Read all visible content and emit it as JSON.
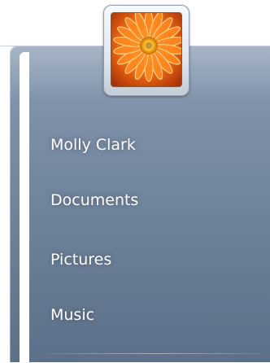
{
  "start_menu": {
    "user_picture_icon": "orange-gerbera-flower",
    "right_column": {
      "items": [
        {
          "label": "Molly Clark"
        },
        {
          "label": "Documents"
        },
        {
          "label": "Pictures"
        },
        {
          "label": "Music"
        }
      ]
    }
  },
  "colors": {
    "pane_top": "#8ea0b6",
    "pane_bottom": "#5d7089",
    "text": "#ffffff",
    "flower_orange": "#f07a1a"
  }
}
